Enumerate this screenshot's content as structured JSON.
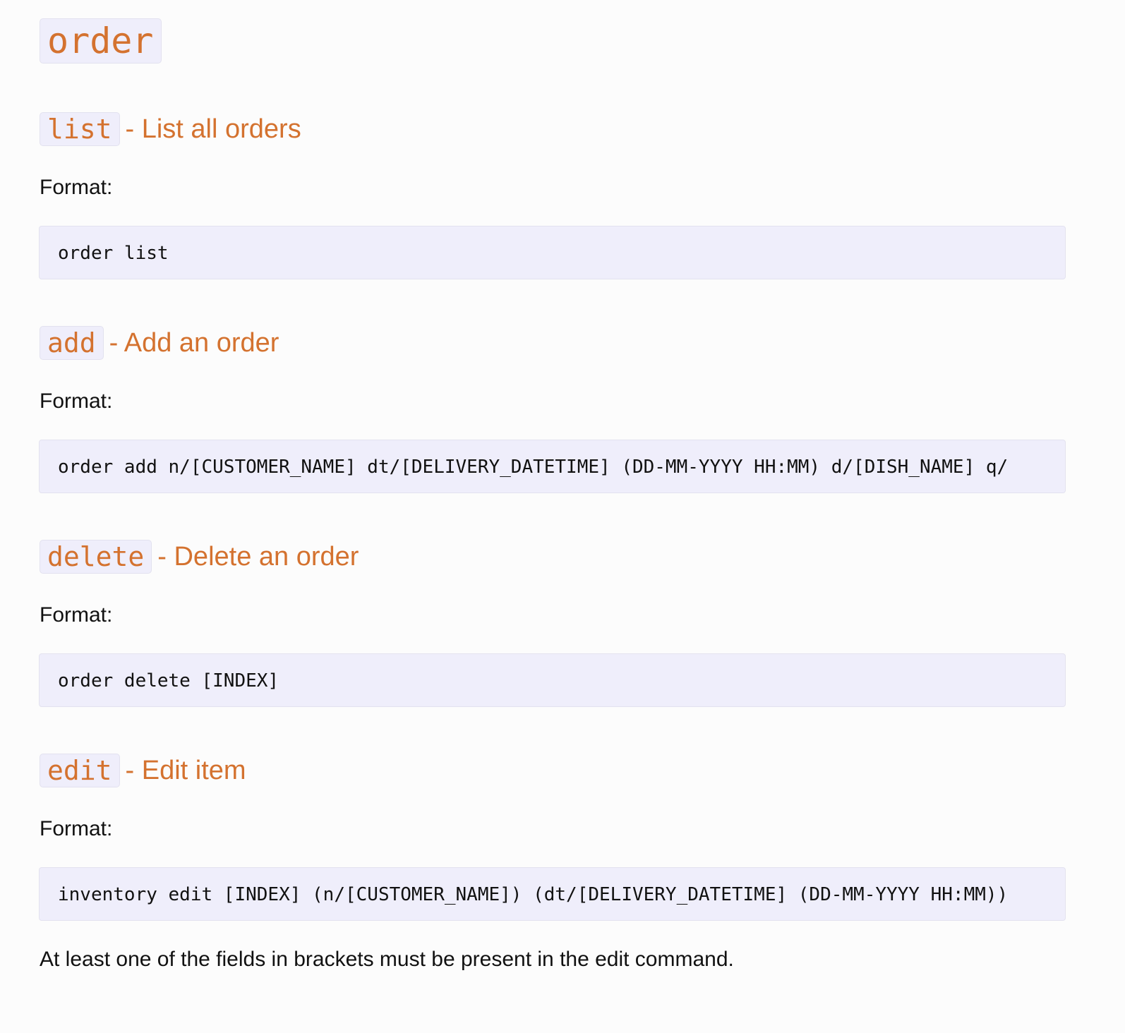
{
  "title": "order",
  "sections": [
    {
      "command": "list",
      "description": "- List all orders",
      "format_label": "Format:",
      "format": "order list"
    },
    {
      "command": "add",
      "description": "- Add an order",
      "format_label": "Format:",
      "format": "order add n/[CUSTOMER_NAME] dt/[DELIVERY_DATETIME] (DD-MM-YYYY HH:MM) d/[DISH_NAME] q/"
    },
    {
      "command": "delete",
      "description": "- Delete an order",
      "format_label": "Format:",
      "format": "order delete [INDEX]"
    },
    {
      "command": "edit",
      "description": "- Edit item",
      "format_label": "Format:",
      "format": "inventory edit [INDEX] (n/[CUSTOMER_NAME]) (dt/[DELIVERY_DATETIME] (DD-MM-YYYY HH:MM))"
    }
  ],
  "note": "At least one of the fields in brackets must be present in the edit command."
}
